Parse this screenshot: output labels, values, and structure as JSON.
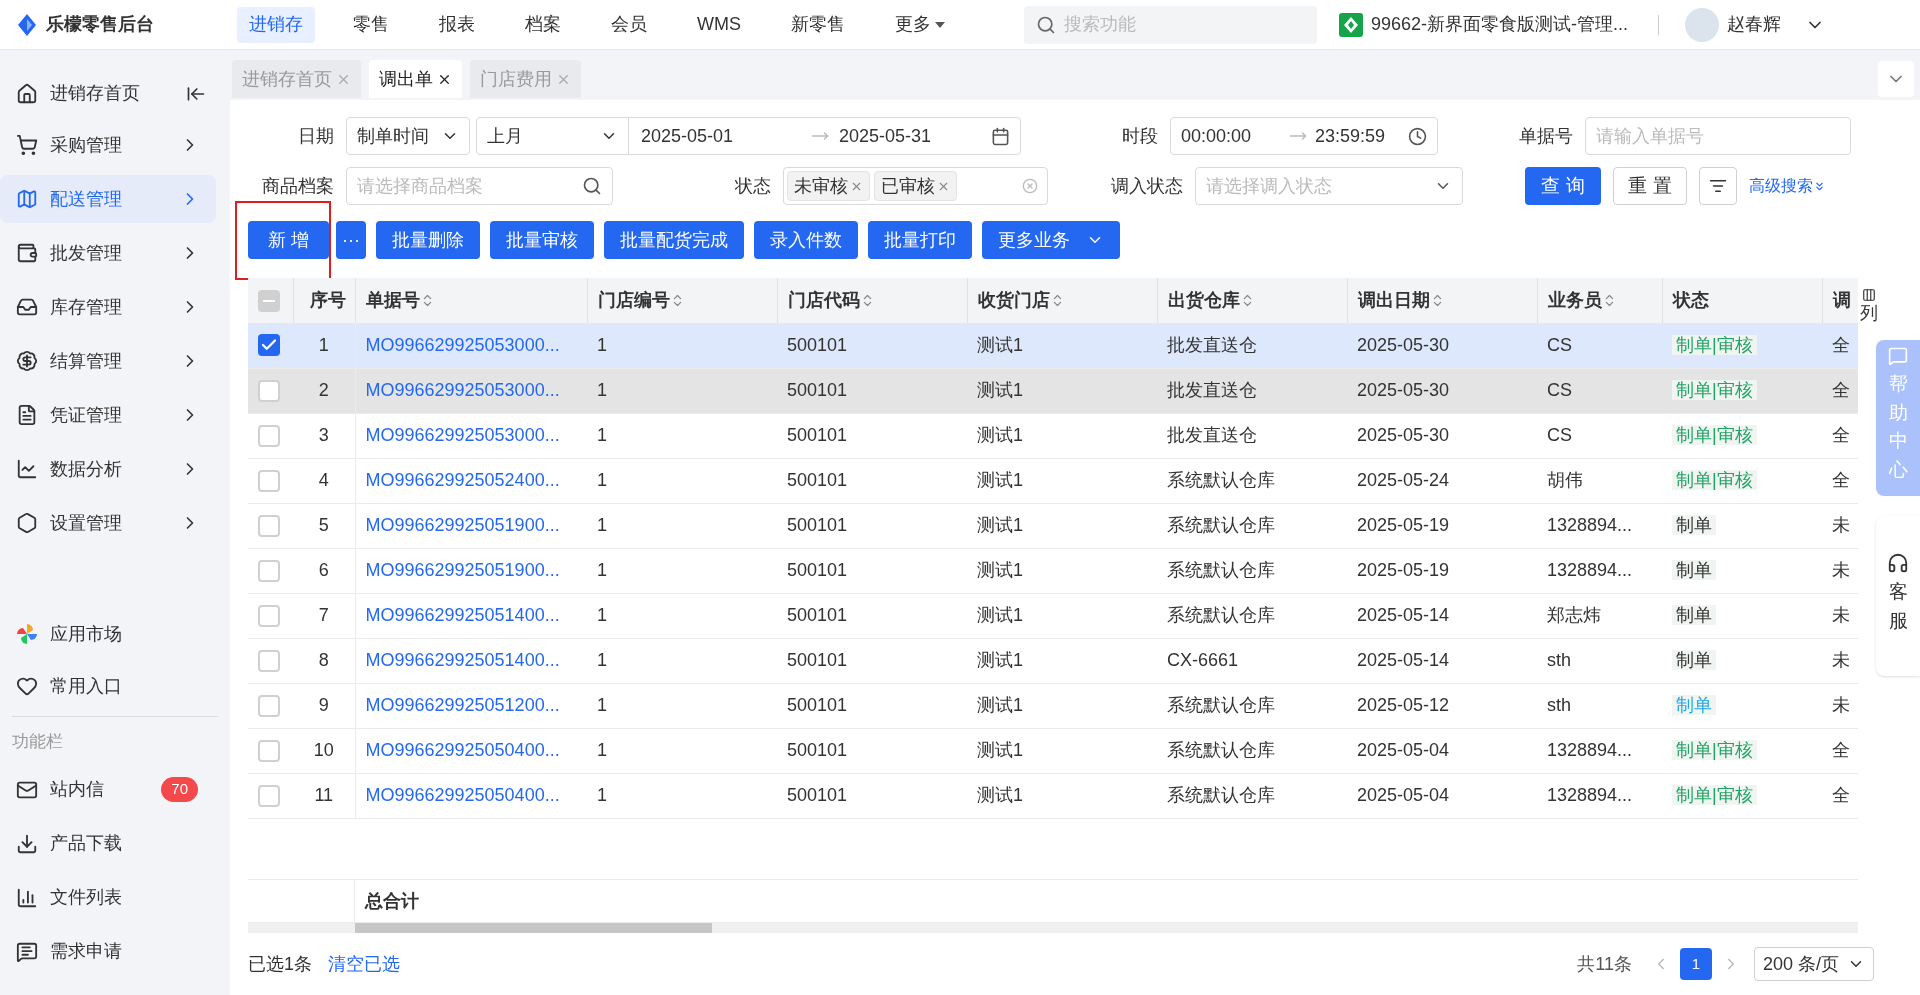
{
  "app": {
    "logo_text": "乐檬零售后台",
    "search_placeholder": "搜索功能",
    "store": "99662-新界面零食版测试-管理...",
    "user": "赵春辉"
  },
  "top_nav": [
    {
      "label": "进销存",
      "selected": true,
      "kind": "link"
    },
    {
      "label": "零售",
      "selected": false,
      "kind": "link"
    },
    {
      "label": "报表",
      "selected": false,
      "kind": "link"
    },
    {
      "label": "档案",
      "selected": false,
      "kind": "link"
    },
    {
      "label": "会员",
      "selected": false,
      "kind": "link"
    },
    {
      "label": "WMS",
      "selected": false,
      "kind": "link"
    },
    {
      "label": "新零售",
      "selected": false,
      "kind": "link"
    },
    {
      "label": "更多",
      "selected": false,
      "kind": "dropdown"
    }
  ],
  "sidebar": {
    "home": "进销存首页",
    "items": [
      {
        "label": "采购管理",
        "selected": false
      },
      {
        "label": "配送管理",
        "selected": true
      },
      {
        "label": "批发管理",
        "selected": false
      },
      {
        "label": "库存管理",
        "selected": false
      },
      {
        "label": "结算管理",
        "selected": false
      },
      {
        "label": "凭证管理",
        "selected": false
      },
      {
        "label": "数据分析",
        "selected": false
      },
      {
        "label": "设置管理",
        "selected": false
      }
    ],
    "extras": [
      {
        "label": "应用市场"
      },
      {
        "label": "常用入口"
      }
    ],
    "section_title": "功能栏",
    "functions": [
      {
        "label": "站内信",
        "badge": "70"
      },
      {
        "label": "产品下载"
      },
      {
        "label": "文件列表"
      },
      {
        "label": "需求申请"
      }
    ]
  },
  "page_tabs": [
    {
      "label": "进销存首页",
      "selected": false
    },
    {
      "label": "调出单",
      "selected": true
    },
    {
      "label": "门店费用",
      "selected": false
    }
  ],
  "filters": {
    "date_label": "日期",
    "date_type": "制单时间",
    "date_range": "上月",
    "date_start": "2025-05-01",
    "date_end": "2025-05-31",
    "time_label": "时段",
    "time_start": "00:00:00",
    "time_end": "23:59:59",
    "doc_label": "单据号",
    "doc_placeholder": "请输入单据号",
    "goods_label": "商品档案",
    "goods_placeholder": "请选择商品档案",
    "status_label": "状态",
    "status_tags": [
      "未审核",
      "已审核"
    ],
    "in_status_label": "调入状态",
    "in_status_placeholder": "请选择调入状态",
    "query": "查 询",
    "reset": "重 置",
    "advanced": "高级搜索"
  },
  "actions": [
    {
      "label": "新 增",
      "kind": "button",
      "highlighted": true
    },
    {
      "label": "···",
      "kind": "more",
      "highlighted": false
    },
    {
      "label": "批量删除",
      "kind": "button",
      "highlighted": false
    },
    {
      "label": "批量审核",
      "kind": "button",
      "highlighted": false
    },
    {
      "label": "批量配货完成",
      "kind": "button",
      "highlighted": false
    },
    {
      "label": "录入件数",
      "kind": "button",
      "highlighted": false
    },
    {
      "label": "批量打印",
      "kind": "button",
      "highlighted": false
    },
    {
      "label": "更多业务",
      "kind": "dropdown",
      "highlighted": false
    }
  ],
  "table": {
    "columns": [
      {
        "label": "序号",
        "sortable": false
      },
      {
        "label": "单据号",
        "sortable": true
      },
      {
        "label": "门店编号",
        "sortable": true
      },
      {
        "label": "门店代码",
        "sortable": true
      },
      {
        "label": "收货门店",
        "sortable": true
      },
      {
        "label": "出货仓库",
        "sortable": true
      },
      {
        "label": "调出日期",
        "sortable": true
      },
      {
        "label": "业务员",
        "sortable": true
      },
      {
        "label": "状态",
        "sortable": false
      },
      {
        "label": "调",
        "sortable": false
      }
    ],
    "column_settings": "列",
    "select_all_partial": true,
    "rows": [
      {
        "checked": true,
        "hovered": false,
        "cells": [
          "1",
          "MO996629925053000...",
          "1",
          "500101",
          "测试1",
          "批发直送仓",
          "2025-05-30",
          "CS"
        ],
        "status": {
          "text": "制单|审核",
          "color": "#21a366"
        },
        "column_10": "全"
      },
      {
        "checked": false,
        "hovered": true,
        "cells": [
          "2",
          "MO996629925053000...",
          "1",
          "500101",
          "测试1",
          "批发直送仓",
          "2025-05-30",
          "CS"
        ],
        "status": {
          "text": "制单|审核",
          "color": "#21a366"
        },
        "column_10": "全"
      },
      {
        "checked": false,
        "hovered": false,
        "cells": [
          "3",
          "MO996629925053000...",
          "1",
          "500101",
          "测试1",
          "批发直送仓",
          "2025-05-30",
          "CS"
        ],
        "status": {
          "text": "制单|审核",
          "color": "#21a366"
        },
        "column_10": "全"
      },
      {
        "checked": false,
        "hovered": false,
        "cells": [
          "4",
          "MO996629925052400...",
          "1",
          "500101",
          "测试1",
          "系统默认仓库",
          "2025-05-24",
          "胡伟"
        ],
        "status": {
          "text": "制单|审核",
          "color": "#21a366"
        },
        "column_10": "全"
      },
      {
        "checked": false,
        "hovered": false,
        "cells": [
          "5",
          "MO996629925051900...",
          "1",
          "500101",
          "测试1",
          "系统默认仓库",
          "2025-05-19",
          "1328894..."
        ],
        "status": {
          "text": "制单",
          "color": "#333333"
        },
        "column_10": "未"
      },
      {
        "checked": false,
        "hovered": false,
        "cells": [
          "6",
          "MO996629925051900...",
          "1",
          "500101",
          "测试1",
          "系统默认仓库",
          "2025-05-19",
          "1328894..."
        ],
        "status": {
          "text": "制单",
          "color": "#333333"
        },
        "column_10": "未"
      },
      {
        "checked": false,
        "hovered": false,
        "cells": [
          "7",
          "MO996629925051400...",
          "1",
          "500101",
          "测试1",
          "系统默认仓库",
          "2025-05-14",
          "郑志炜"
        ],
        "status": {
          "text": "制单",
          "color": "#333333"
        },
        "column_10": "未"
      },
      {
        "checked": false,
        "hovered": false,
        "cells": [
          "8",
          "MO996629925051400...",
          "1",
          "500101",
          "测试1",
          "CX-6661",
          "2025-05-14",
          "sth"
        ],
        "status": {
          "text": "制单",
          "color": "#333333"
        },
        "column_10": "未"
      },
      {
        "checked": false,
        "hovered": false,
        "cells": [
          "9",
          "MO996629925051200...",
          "1",
          "500101",
          "测试1",
          "系统默认仓库",
          "2025-05-12",
          "sth"
        ],
        "status": {
          "text": "制单",
          "color": "#1fa8e6"
        },
        "column_10": "未"
      },
      {
        "checked": false,
        "hovered": false,
        "cells": [
          "10",
          "MO996629925050400...",
          "1",
          "500101",
          "测试1",
          "系统默认仓库",
          "2025-05-04",
          "1328894..."
        ],
        "status": {
          "text": "制单|审核",
          "color": "#21a366"
        },
        "column_10": "全"
      },
      {
        "checked": false,
        "hovered": false,
        "cells": [
          "11",
          "MO996629925050400...",
          "1",
          "500101",
          "测试1",
          "系统默认仓库",
          "2025-05-04",
          "1328894..."
        ],
        "status": {
          "text": "制单|审核",
          "color": "#21a366"
        },
        "column_10": "全"
      }
    ],
    "total_label": "总合计"
  },
  "footer": {
    "selected_info": "已选1条",
    "clear": "清空已选",
    "total": "共11条",
    "pages": [
      {
        "label": "1",
        "selected": true
      }
    ],
    "page_size": "200 条/页"
  },
  "float": {
    "help": "帮助中心",
    "service": "客服"
  }
}
